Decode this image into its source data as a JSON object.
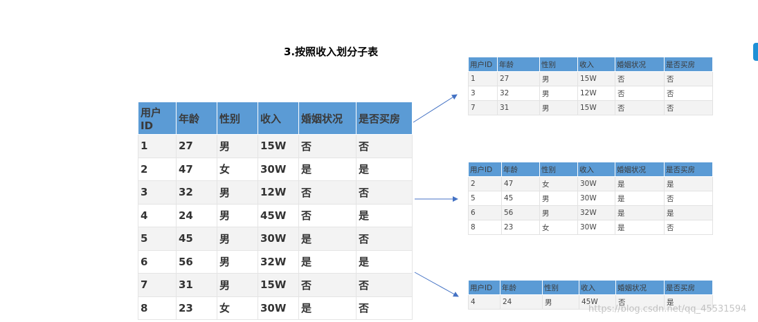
{
  "title": "3.按照收入划分子表",
  "headers": [
    "用户ID",
    "年龄",
    "性别",
    "收入",
    "婚姻状况",
    "是否买房"
  ],
  "main_rows": [
    [
      "1",
      "27",
      "男",
      "15W",
      "否",
      "否"
    ],
    [
      "2",
      "47",
      "女",
      "30W",
      "是",
      "是"
    ],
    [
      "3",
      "32",
      "男",
      "12W",
      "否",
      "否"
    ],
    [
      "4",
      "24",
      "男",
      "45W",
      "否",
      "是"
    ],
    [
      "5",
      "45",
      "男",
      "30W",
      "是",
      "否"
    ],
    [
      "6",
      "56",
      "男",
      "32W",
      "是",
      "是"
    ],
    [
      "7",
      "31",
      "男",
      "15W",
      "否",
      "否"
    ],
    [
      "8",
      "23",
      "女",
      "30W",
      "是",
      "否"
    ]
  ],
  "subtables": [
    {
      "rows": [
        [
          "1",
          "27",
          "男",
          "15W",
          "否",
          "否"
        ],
        [
          "3",
          "32",
          "男",
          "12W",
          "否",
          "否"
        ],
        [
          "7",
          "31",
          "男",
          "15W",
          "否",
          "否"
        ]
      ]
    },
    {
      "rows": [
        [
          "2",
          "47",
          "女",
          "30W",
          "是",
          "是"
        ],
        [
          "5",
          "45",
          "男",
          "30W",
          "是",
          "否"
        ],
        [
          "6",
          "56",
          "男",
          "32W",
          "是",
          "是"
        ],
        [
          "8",
          "23",
          "女",
          "30W",
          "是",
          "否"
        ]
      ]
    },
    {
      "rows": [
        [
          "4",
          "24",
          "男",
          "45W",
          "否",
          "是"
        ]
      ]
    }
  ],
  "watermark": "https://blog.csdn.net/qq_45531594",
  "colors": {
    "header": "#5b9bd5",
    "arrow": "#4472c4",
    "row_alt": "#f3f3f3"
  }
}
